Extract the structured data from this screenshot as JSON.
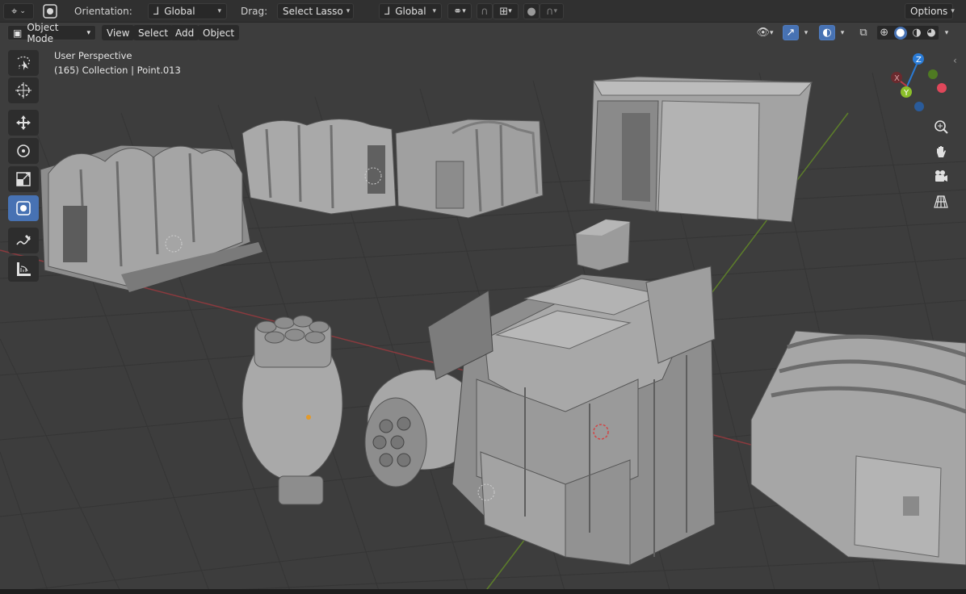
{
  "header": {
    "orientation_label": "Orientation:",
    "orientation_value": "Global",
    "drag_label": "Drag:",
    "drag_value": "Select Lasso",
    "transform_orientation": "Global",
    "options_label": "Options"
  },
  "menubar": {
    "mode": "Object Mode",
    "view": "View",
    "select": "Select",
    "add": "Add",
    "object": "Object"
  },
  "viewport": {
    "perspective": "User Perspective",
    "collection_info": "(165) Collection | Point.013"
  },
  "gizmo": {
    "z": "Z",
    "y": "Y",
    "x": "X"
  },
  "colors": {
    "accent": "#4772b3",
    "viewport_bg": "#3d3d3d",
    "header_bg": "#303030",
    "x_axis": "#c13a45",
    "y_axis": "#6f9a2a",
    "z_axis": "#2a7bd6"
  },
  "icons": {
    "toolbar": [
      "select-lasso-icon",
      "cursor-icon",
      "move-icon",
      "rotate-icon",
      "scale-icon",
      "transform-icon",
      "annotate-icon",
      "measure-icon"
    ],
    "nav": [
      "zoom-icon",
      "pan-hand-icon",
      "camera-icon",
      "grid-perspective-icon"
    ]
  }
}
